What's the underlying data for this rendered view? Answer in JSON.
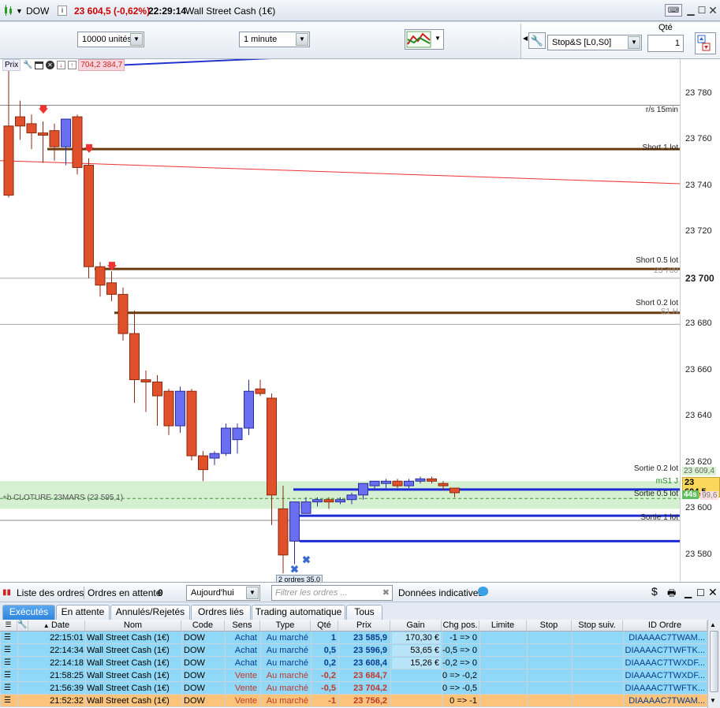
{
  "titlebar": {
    "symbol": "DOW",
    "price_change": "23 604,5 (-0,62%)",
    "time": "22:29:14",
    "instrument": "Wall Street Cash (1€)"
  },
  "toolbar": {
    "quantity_unit": "10000 unités",
    "timeframe": "1 minute",
    "order_type": "Stop&S [L0,S0]",
    "qty_label": "Qté",
    "qty_value": "1"
  },
  "chart": {
    "prix_label": "Prix",
    "prix_values": "704,2 384,7",
    "y_ticks": [
      "23 780",
      "23 760",
      "23 740",
      "23 720",
      "23 700",
      "23 680",
      "23 660",
      "23 640",
      "23 620",
      "23 600",
      "23 580"
    ],
    "y_min": 23568,
    "y_max": 23795,
    "level_labels": {
      "rs": "r/s 15min",
      "short1": "Short 1 lot",
      "short05": "Short 0.5 lot",
      "short02": "Short 0.2 lot",
      "s23700": "23 700",
      "s1h": "S1 H",
      "sortie02": "Sortie 0.2 lot",
      "ms1": "mS1 J",
      "sortie05": "Sortie 0.5 lot",
      "sortie1": "Sortie 1 lot",
      "cloture": "+b CLOTURE 23MARS (23 595,1)"
    },
    "axis_badges": {
      "b1": "23 609,4",
      "current": "23 604,5",
      "timer": "44s",
      "b3": "99,6"
    },
    "mini_tag": "2 ordres 35,0",
    "candles": [
      {
        "o": 23766,
        "h": 23793,
        "l": 23735,
        "c": 23736
      },
      {
        "o": 23770,
        "h": 23777,
        "l": 23760,
        "c": 23766
      },
      {
        "o": 23767,
        "h": 23771,
        "l": 23756,
        "c": 23763
      },
      {
        "o": 23763,
        "h": 23768,
        "l": 23750,
        "c": 23762
      },
      {
        "o": 23764,
        "h": 23767,
        "l": 23751,
        "c": 23757
      },
      {
        "o": 23757,
        "h": 23769,
        "l": 23749,
        "c": 23769
      },
      {
        "o": 23770,
        "h": 23771,
        "l": 23745,
        "c": 23748
      },
      {
        "o": 23749,
        "h": 23752,
        "l": 23700,
        "c": 23705
      },
      {
        "o": 23705,
        "h": 23707,
        "l": 23692,
        "c": 23697
      },
      {
        "o": 23698,
        "h": 23703,
        "l": 23690,
        "c": 23693
      },
      {
        "o": 23693,
        "h": 23696,
        "l": 23673,
        "c": 23676
      },
      {
        "o": 23676,
        "h": 23686,
        "l": 23646,
        "c": 23656
      },
      {
        "o": 23656,
        "h": 23660,
        "l": 23642,
        "c": 23655
      },
      {
        "o": 23655,
        "h": 23658,
        "l": 23636,
        "c": 23649
      },
      {
        "o": 23651,
        "h": 23652,
        "l": 23632,
        "c": 23636
      },
      {
        "o": 23636,
        "h": 23653,
        "l": 23633,
        "c": 23651
      },
      {
        "o": 23651,
        "h": 23652,
        "l": 23621,
        "c": 23623
      },
      {
        "o": 23623,
        "h": 23625,
        "l": 23612,
        "c": 23617
      },
      {
        "o": 23622,
        "h": 23625,
        "l": 23619,
        "c": 23624
      },
      {
        "o": 23624,
        "h": 23637,
        "l": 23623,
        "c": 23635
      },
      {
        "o": 23630,
        "h": 23637,
        "l": 23624,
        "c": 23635
      },
      {
        "o": 23635,
        "h": 23656,
        "l": 23632,
        "c": 23651
      },
      {
        "o": 23652,
        "h": 23656,
        "l": 23649,
        "c": 23650
      },
      {
        "o": 23648,
        "h": 23650,
        "l": 23593,
        "c": 23606
      },
      {
        "o": 23600,
        "h": 23610,
        "l": 23572,
        "c": 23580
      },
      {
        "o": 23586,
        "h": 23603,
        "l": 23576,
        "c": 23603
      },
      {
        "o": 23598,
        "h": 23605,
        "l": 23598,
        "c": 23603
      },
      {
        "o": 23603,
        "h": 23605,
        "l": 23601,
        "c": 23604
      },
      {
        "o": 23604,
        "h": 23605,
        "l": 23600,
        "c": 23603
      },
      {
        "o": 23603,
        "h": 23605,
        "l": 23602,
        "c": 23604
      },
      {
        "o": 23604,
        "h": 23607,
        "l": 23602,
        "c": 23606
      },
      {
        "o": 23606,
        "h": 23610,
        "l": 23604,
        "c": 23611
      },
      {
        "o": 23610,
        "h": 23612,
        "l": 23608,
        "c": 23612
      },
      {
        "o": 23611,
        "h": 23613,
        "l": 23609,
        "c": 23612
      },
      {
        "o": 23612,
        "h": 23613,
        "l": 23609,
        "c": 23610
      },
      {
        "o": 23610,
        "h": 23613,
        "l": 23609,
        "c": 23612
      },
      {
        "o": 23612,
        "h": 23614,
        "l": 23611,
        "c": 23613
      },
      {
        "o": 23613,
        "h": 23614,
        "l": 23611,
        "c": 23612
      },
      {
        "o": 23611,
        "h": 23612,
        "l": 23608,
        "c": 23610
      },
      {
        "o": 23609,
        "h": 23609,
        "l": 23605,
        "c": 23607
      }
    ]
  },
  "orders_bar": {
    "title": "Liste des ordres",
    "pending_label": "Ordres en attente",
    "pending_count": "0",
    "period": "Aujourd'hui",
    "filter_placeholder": "Filtrer les ordres ...",
    "note": "Données indicatives"
  },
  "tabs": [
    "Exécutés",
    "En attente",
    "Annulés/Rejetés",
    "Ordres liés",
    "Trading automatique",
    "Tous"
  ],
  "table": {
    "headers": [
      "Date",
      "Nom",
      "Code",
      "Sens",
      "Type",
      "Qté",
      "Prix",
      "Gain",
      "Chg pos.",
      "Limite",
      "Stop",
      "Stop suiv.",
      "ID Ordre"
    ],
    "rows": [
      {
        "date": "22:15:01",
        "nom": "Wall Street Cash (1€)",
        "code": "DOW",
        "sens": "Achat",
        "type": "Au marché",
        "qte": "1",
        "prix": "23 585,9",
        "gain": "170,30 €",
        "chg": "-1 => 0",
        "id": "DIAAAAC7TWAM..."
      },
      {
        "date": "22:14:34",
        "nom": "Wall Street Cash (1€)",
        "code": "DOW",
        "sens": "Achat",
        "type": "Au marché",
        "qte": "0,5",
        "prix": "23 596,9",
        "gain": "53,65 €",
        "chg": "-0,5 => 0",
        "id": "DIAAAAC7TWFTK..."
      },
      {
        "date": "22:14:18",
        "nom": "Wall Street Cash (1€)",
        "code": "DOW",
        "sens": "Achat",
        "type": "Au marché",
        "qte": "0,2",
        "prix": "23 608,4",
        "gain": "15,26 €",
        "chg": "-0,2 => 0",
        "id": "DIAAAAC7TWXDF..."
      },
      {
        "date": "21:58:25",
        "nom": "Wall Street Cash (1€)",
        "code": "DOW",
        "sens": "Vente",
        "type": "Au marché",
        "qte": "-0,2",
        "prix": "23 684,7",
        "gain": "",
        "chg": "0 => -0,2",
        "id": "DIAAAAC7TWXDF..."
      },
      {
        "date": "21:56:39",
        "nom": "Wall Street Cash (1€)",
        "code": "DOW",
        "sens": "Vente",
        "type": "Au marché",
        "qte": "-0,5",
        "prix": "23 704,2",
        "gain": "",
        "chg": "0 => -0,5",
        "id": "DIAAAAC7TWFTK..."
      },
      {
        "date": "21:52:32",
        "nom": "Wall Street Cash (1€)",
        "code": "DOW",
        "sens": "Vente",
        "type": "Au marché",
        "qte": "-1",
        "prix": "23 756,2",
        "gain": "",
        "chg": "0 => -1",
        "id": "DIAAAAC7TWAM..."
      }
    ]
  }
}
